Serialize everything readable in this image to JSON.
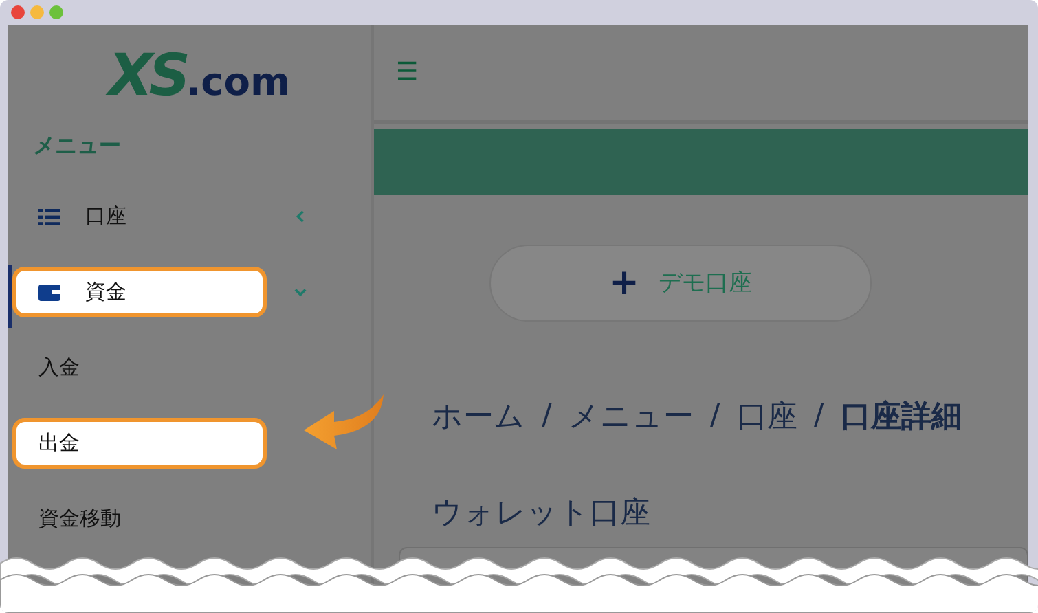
{
  "logo": {
    "mark": "XS",
    "suffix": ".com"
  },
  "sidebar": {
    "heading": "メニュー",
    "items": [
      {
        "label": "口座",
        "kind": "list",
        "expanded": false,
        "selected": false,
        "highlighted": false
      },
      {
        "label": "資金",
        "kind": "wallet",
        "expanded": true,
        "selected": true,
        "highlighted": true,
        "children": [
          {
            "label": "入金",
            "highlighted": false
          },
          {
            "label": "出金",
            "highlighted": true
          },
          {
            "label": "資金移動",
            "highlighted": false
          }
        ]
      }
    ]
  },
  "header": {
    "menu_glyph": "☰"
  },
  "demo_button": {
    "icon": "+",
    "label": "デモ口座"
  },
  "breadcrumb": [
    {
      "label": "ホーム",
      "current": false
    },
    {
      "label": "メニュー",
      "current": false
    },
    {
      "label": "口座",
      "current": false
    },
    {
      "label": "口座詳細",
      "current": true
    }
  ],
  "separator": "/",
  "section_title": "ウォレット口座"
}
